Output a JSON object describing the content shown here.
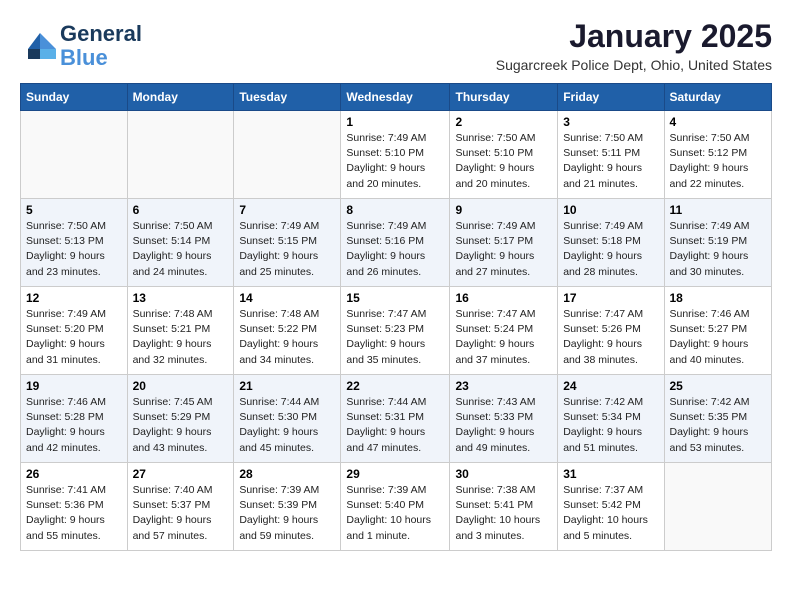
{
  "header": {
    "logo_line1": "General",
    "logo_line2": "Blue",
    "month": "January 2025",
    "location": "Sugarcreek Police Dept, Ohio, United States"
  },
  "weekdays": [
    "Sunday",
    "Monday",
    "Tuesday",
    "Wednesday",
    "Thursday",
    "Friday",
    "Saturday"
  ],
  "weeks": [
    [
      {
        "day": "",
        "info": ""
      },
      {
        "day": "",
        "info": ""
      },
      {
        "day": "",
        "info": ""
      },
      {
        "day": "1",
        "info": "Sunrise: 7:49 AM\nSunset: 5:10 PM\nDaylight: 9 hours\nand 20 minutes."
      },
      {
        "day": "2",
        "info": "Sunrise: 7:50 AM\nSunset: 5:10 PM\nDaylight: 9 hours\nand 20 minutes."
      },
      {
        "day": "3",
        "info": "Sunrise: 7:50 AM\nSunset: 5:11 PM\nDaylight: 9 hours\nand 21 minutes."
      },
      {
        "day": "4",
        "info": "Sunrise: 7:50 AM\nSunset: 5:12 PM\nDaylight: 9 hours\nand 22 minutes."
      }
    ],
    [
      {
        "day": "5",
        "info": "Sunrise: 7:50 AM\nSunset: 5:13 PM\nDaylight: 9 hours\nand 23 minutes."
      },
      {
        "day": "6",
        "info": "Sunrise: 7:50 AM\nSunset: 5:14 PM\nDaylight: 9 hours\nand 24 minutes."
      },
      {
        "day": "7",
        "info": "Sunrise: 7:49 AM\nSunset: 5:15 PM\nDaylight: 9 hours\nand 25 minutes."
      },
      {
        "day": "8",
        "info": "Sunrise: 7:49 AM\nSunset: 5:16 PM\nDaylight: 9 hours\nand 26 minutes."
      },
      {
        "day": "9",
        "info": "Sunrise: 7:49 AM\nSunset: 5:17 PM\nDaylight: 9 hours\nand 27 minutes."
      },
      {
        "day": "10",
        "info": "Sunrise: 7:49 AM\nSunset: 5:18 PM\nDaylight: 9 hours\nand 28 minutes."
      },
      {
        "day": "11",
        "info": "Sunrise: 7:49 AM\nSunset: 5:19 PM\nDaylight: 9 hours\nand 30 minutes."
      }
    ],
    [
      {
        "day": "12",
        "info": "Sunrise: 7:49 AM\nSunset: 5:20 PM\nDaylight: 9 hours\nand 31 minutes."
      },
      {
        "day": "13",
        "info": "Sunrise: 7:48 AM\nSunset: 5:21 PM\nDaylight: 9 hours\nand 32 minutes."
      },
      {
        "day": "14",
        "info": "Sunrise: 7:48 AM\nSunset: 5:22 PM\nDaylight: 9 hours\nand 34 minutes."
      },
      {
        "day": "15",
        "info": "Sunrise: 7:47 AM\nSunset: 5:23 PM\nDaylight: 9 hours\nand 35 minutes."
      },
      {
        "day": "16",
        "info": "Sunrise: 7:47 AM\nSunset: 5:24 PM\nDaylight: 9 hours\nand 37 minutes."
      },
      {
        "day": "17",
        "info": "Sunrise: 7:47 AM\nSunset: 5:26 PM\nDaylight: 9 hours\nand 38 minutes."
      },
      {
        "day": "18",
        "info": "Sunrise: 7:46 AM\nSunset: 5:27 PM\nDaylight: 9 hours\nand 40 minutes."
      }
    ],
    [
      {
        "day": "19",
        "info": "Sunrise: 7:46 AM\nSunset: 5:28 PM\nDaylight: 9 hours\nand 42 minutes."
      },
      {
        "day": "20",
        "info": "Sunrise: 7:45 AM\nSunset: 5:29 PM\nDaylight: 9 hours\nand 43 minutes."
      },
      {
        "day": "21",
        "info": "Sunrise: 7:44 AM\nSunset: 5:30 PM\nDaylight: 9 hours\nand 45 minutes."
      },
      {
        "day": "22",
        "info": "Sunrise: 7:44 AM\nSunset: 5:31 PM\nDaylight: 9 hours\nand 47 minutes."
      },
      {
        "day": "23",
        "info": "Sunrise: 7:43 AM\nSunset: 5:33 PM\nDaylight: 9 hours\nand 49 minutes."
      },
      {
        "day": "24",
        "info": "Sunrise: 7:42 AM\nSunset: 5:34 PM\nDaylight: 9 hours\nand 51 minutes."
      },
      {
        "day": "25",
        "info": "Sunrise: 7:42 AM\nSunset: 5:35 PM\nDaylight: 9 hours\nand 53 minutes."
      }
    ],
    [
      {
        "day": "26",
        "info": "Sunrise: 7:41 AM\nSunset: 5:36 PM\nDaylight: 9 hours\nand 55 minutes."
      },
      {
        "day": "27",
        "info": "Sunrise: 7:40 AM\nSunset: 5:37 PM\nDaylight: 9 hours\nand 57 minutes."
      },
      {
        "day": "28",
        "info": "Sunrise: 7:39 AM\nSunset: 5:39 PM\nDaylight: 9 hours\nand 59 minutes."
      },
      {
        "day": "29",
        "info": "Sunrise: 7:39 AM\nSunset: 5:40 PM\nDaylight: 10 hours\nand 1 minute."
      },
      {
        "day": "30",
        "info": "Sunrise: 7:38 AM\nSunset: 5:41 PM\nDaylight: 10 hours\nand 3 minutes."
      },
      {
        "day": "31",
        "info": "Sunrise: 7:37 AM\nSunset: 5:42 PM\nDaylight: 10 hours\nand 5 minutes."
      },
      {
        "day": "",
        "info": ""
      }
    ]
  ]
}
